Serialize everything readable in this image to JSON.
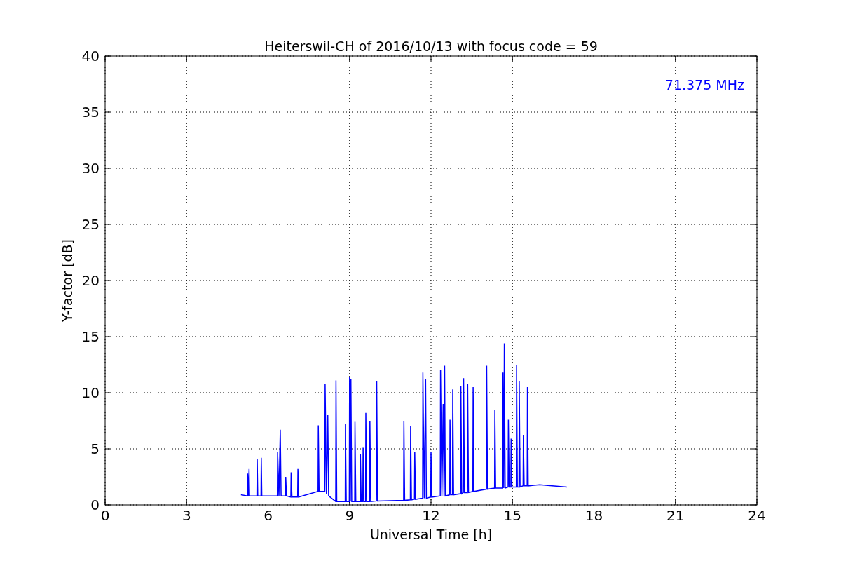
{
  "figure": {
    "chart_data": {
      "type": "line",
      "title": "Heiterswil-CH of 2016/10/13 with focus code = 59",
      "xlabel": "Universal Time [h]",
      "ylabel": "Y-factor [dB]",
      "x": [
        5,
        5.24,
        5.25,
        5.27,
        5.3,
        5.32,
        5.59,
        5.6,
        5.62,
        5.74,
        5.75,
        5.77,
        6.34,
        6.35,
        6.4,
        6.45,
        6.48,
        6.64,
        6.65,
        6.68,
        6.84,
        6.85,
        6.88,
        7.09,
        7.1,
        7.13,
        7.84,
        7.85,
        7.88,
        8.09,
        8.1,
        8.15,
        8.2,
        8.23,
        8.49,
        8.5,
        8.53,
        8.84,
        8.85,
        8.88,
        8.99,
        9.0,
        9.03,
        9.05,
        9.08,
        9.19,
        9.2,
        9.23,
        9.39,
        9.4,
        9.43,
        9.49,
        9.5,
        9.53,
        9.59,
        9.6,
        9.63,
        9.74,
        9.75,
        9.78,
        9.99,
        10.0,
        10.03,
        10.99,
        11.0,
        11.03,
        11.24,
        11.25,
        11.28,
        11.39,
        11.4,
        11.43,
        11.69,
        11.7,
        11.75,
        11.8,
        11.83,
        11.99,
        12.0,
        12.03,
        12.34,
        12.35,
        12.4,
        12.45,
        12.48,
        12.5,
        12.53,
        12.69,
        12.7,
        12.73,
        12.79,
        12.8,
        12.83,
        13.09,
        13.1,
        13.13,
        13.19,
        13.2,
        13.23,
        13.34,
        13.35,
        13.38,
        13.54,
        13.55,
        13.58,
        14.04,
        14.05,
        14.08,
        14.34,
        14.35,
        14.38,
        14.64,
        14.65,
        14.68,
        14.7,
        14.73,
        14.84,
        14.85,
        14.88,
        14.94,
        14.95,
        14.98,
        15.14,
        15.15,
        15.18,
        15.24,
        15.25,
        15.28,
        15.39,
        15.4,
        15.43,
        15.54,
        15.55,
        15.58,
        16,
        17
      ],
      "series": [
        {
          "name": "71.375 MHz",
          "color": "#0000ff",
          "values": [
            0.9,
            0.8,
            2.8,
            0.8,
            3.2,
            0.8,
            0.8,
            4.1,
            0.8,
            0.8,
            4.2,
            0.8,
            0.8,
            4.7,
            0.8,
            6.7,
            0.8,
            0.8,
            2.5,
            0.8,
            0.7,
            2.9,
            0.7,
            0.7,
            3.2,
            0.7,
            1.2,
            7.1,
            1.2,
            1.2,
            10.8,
            1.0,
            8.0,
            0.8,
            0.3,
            11.1,
            0.3,
            0.3,
            7.2,
            0.3,
            0.3,
            11.4,
            0.3,
            11.2,
            0.3,
            0.3,
            7.4,
            0.3,
            0.3,
            4.5,
            0.3,
            0.3,
            5.1,
            0.3,
            0.3,
            8.2,
            0.3,
            0.3,
            7.5,
            0.3,
            0.35,
            11.0,
            0.35,
            0.4,
            7.5,
            0.4,
            0.45,
            7.0,
            0.45,
            0.5,
            4.7,
            0.5,
            0.6,
            11.8,
            0.6,
            11.2,
            0.6,
            0.7,
            4.7,
            0.7,
            0.8,
            12.0,
            0.8,
            9.0,
            0.8,
            12.4,
            0.8,
            0.9,
            7.6,
            0.9,
            0.9,
            10.3,
            0.9,
            1.0,
            10.6,
            1.0,
            1.1,
            11.3,
            1.1,
            1.1,
            10.8,
            1.1,
            1.2,
            10.5,
            1.2,
            1.4,
            12.4,
            1.4,
            1.5,
            8.5,
            1.5,
            1.5,
            11.8,
            1.5,
            14.4,
            1.5,
            1.6,
            7.6,
            1.6,
            1.6,
            5.9,
            1.6,
            1.6,
            12.5,
            1.6,
            1.6,
            11.0,
            1.6,
            1.7,
            6.2,
            1.7,
            1.7,
            10.5,
            1.7,
            1.8,
            1.6
          ]
        }
      ],
      "xlim": [
        0,
        24
      ],
      "ylim": [
        0,
        40
      ],
      "xticks": [
        0,
        3,
        6,
        9,
        12,
        15,
        18,
        21,
        24
      ],
      "yticks": [
        0,
        5,
        10,
        15,
        20,
        25,
        30,
        35,
        40
      ],
      "grid": true
    }
  }
}
